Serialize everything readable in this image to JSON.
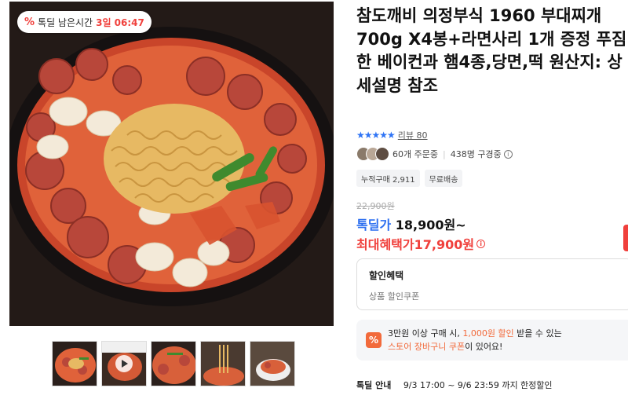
{
  "badge": {
    "icon": "%",
    "label": "톡딜 남은시간",
    "time": "3일 06:47"
  },
  "product": {
    "title": "참도깨비 의정부식 1960 부대찌개 700g X4봉+라면사리 1개 증정 푸짐한 베이컨과 햄4종,당면,떡 원산지: 상세설명 참조",
    "stars": "★★★★★",
    "review_link": "리뷰 80",
    "orders": "60개 주문중",
    "watching": "438명 구경중",
    "tags": [
      "누적구매 2,911",
      "무료배송"
    ],
    "original_price": "22,900원",
    "deal_label": "톡딜가",
    "deal_price": "18,900원~",
    "max_label": "최대혜택가",
    "max_price": "17,900원"
  },
  "discount": {
    "heading": "할인혜택",
    "sub": "상품 할인쿠폰"
  },
  "coupon": {
    "icon": "%",
    "line1_a": "3만원 이상 구매 시, ",
    "line1_hl": "1,000원 할인",
    "line1_b": " 받을 수 있는",
    "line2_hl": "스토어 장바구니 쿠폰",
    "line2_b": "이 있어요!"
  },
  "notice": {
    "label": "톡딜 안내",
    "text": "9/3 17:00 ~ 9/6 23:59 까지 한정할인"
  },
  "thumbnails": [
    "thumb-1",
    "thumb-2-video",
    "thumb-3",
    "thumb-4",
    "thumb-5"
  ],
  "colors": {
    "accent_red": "#f0403c",
    "deal_blue": "#2d6ff0",
    "star_blue": "#2f74f5",
    "coupon_orange": "#f26a3b"
  }
}
